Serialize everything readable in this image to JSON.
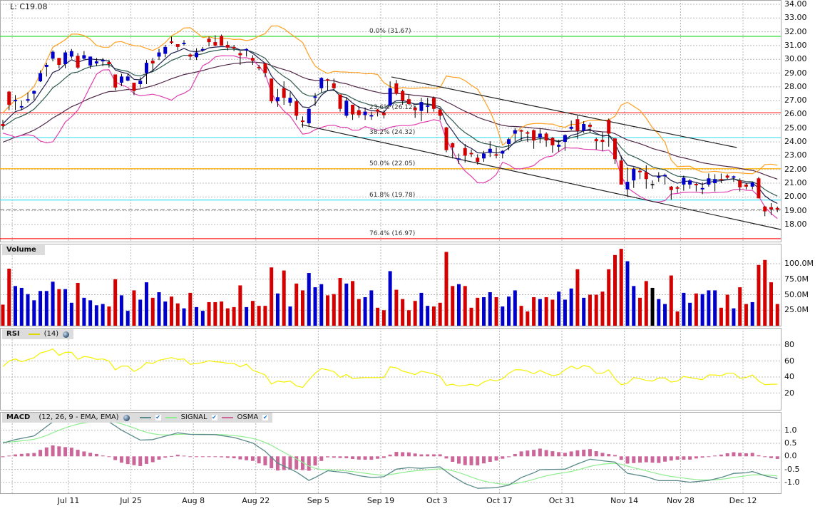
{
  "header": {
    "last_label": "L: C19.08"
  },
  "colors": {
    "up": "#0000cc",
    "down": "#d40000",
    "flat": "#000000",
    "bollinger_upper": "#ffa020",
    "bollinger_lower": "#e040b0",
    "ma_fast": "#202050",
    "ma_mid": "#2d5a50",
    "ma_slow": "#502848",
    "rsi": "#f5f000",
    "macd": "#5a8a8a",
    "signal": "#90ee90",
    "osma": "#cc6699",
    "fib_0": "#33dd33",
    "fib_23_6": "#ff2020",
    "fib_38_2": "#40e0f0",
    "fib_50": "#ffb000",
    "fib_61_8": "#40e0f0",
    "fib_76_4": "#ff2020",
    "grid": "#b8b8b8"
  },
  "panels": {
    "volume": {
      "title": "Volume"
    },
    "rsi": {
      "title": "RSI",
      "params": "(14)"
    },
    "macd": {
      "title": "MACD",
      "params": "(12, 26, 9 - EMA, EMA)",
      "signal_label": "SIGNAL",
      "osma_label": "OSMA"
    }
  },
  "x_axis": {
    "labels": [
      "Jul 11",
      "Jul 25",
      "Aug 8",
      "Aug 22",
      "Sep 5",
      "Sep 19",
      "Oct 3",
      "Oct 17",
      "Oct 31",
      "Nov 14",
      "Nov 28",
      "Dec 12"
    ]
  },
  "chart_data": [
    {
      "type": "candlestick",
      "ylim": [
        17.0,
        34.3
      ],
      "y_ticks": [
        "34.00",
        "33.00",
        "32.00",
        "31.00",
        "30.00",
        "29.00",
        "28.00",
        "27.00",
        "26.00",
        "25.00",
        "24.00",
        "23.00",
        "22.00",
        "21.00",
        "20.00",
        "19.00",
        "18.00"
      ],
      "last_close": 19.08,
      "ohlc": [
        [
          25.3,
          25.6,
          24.9,
          25.15
        ],
        [
          27.65,
          27.7,
          26.3,
          26.7
        ],
        [
          26.95,
          27.4,
          26.3,
          27.05
        ],
        [
          26.5,
          27.0,
          26.3,
          26.6
        ],
        [
          27.0,
          27.6,
          26.85,
          27.1
        ],
        [
          27.5,
          27.75,
          27.05,
          27.7
        ],
        [
          28.4,
          29.2,
          28.35,
          29.0
        ],
        [
          29.45,
          29.75,
          28.75,
          29.6
        ],
        [
          30.05,
          30.65,
          29.85,
          30.55
        ],
        [
          30.1,
          30.1,
          29.35,
          29.6
        ],
        [
          29.65,
          30.65,
          29.35,
          30.5
        ],
        [
          30.2,
          30.75,
          30.05,
          30.6
        ],
        [
          30.25,
          30.45,
          29.3,
          29.4
        ],
        [
          30.05,
          30.6,
          30.0,
          30.3
        ],
        [
          29.55,
          30.2,
          29.3,
          30.2
        ],
        [
          29.7,
          30.1,
          29.5,
          29.85
        ],
        [
          29.85,
          30.1,
          29.5,
          29.95
        ],
        [
          29.8,
          29.95,
          29.4,
          29.65
        ],
        [
          28.9,
          28.9,
          27.75,
          27.95
        ],
        [
          28.3,
          28.95,
          28.05,
          28.75
        ],
        [
          28.45,
          28.95,
          28.4,
          28.75
        ],
        [
          28.3,
          28.3,
          27.4,
          27.7
        ],
        [
          28.2,
          28.7,
          27.95,
          28.45
        ],
        [
          29.0,
          29.95,
          28.2,
          29.75
        ],
        [
          29.9,
          30.1,
          29.1,
          29.7
        ],
        [
          30.2,
          30.75,
          29.95,
          30.5
        ],
        [
          30.4,
          31.05,
          30.15,
          30.9
        ],
        [
          31.3,
          31.65,
          31.1,
          31.2
        ],
        [
          31.1,
          31.1,
          30.65,
          30.9
        ],
        [
          31.1,
          31.4,
          31.0,
          31.2
        ],
        [
          30.35,
          30.45,
          29.95,
          30.2
        ],
        [
          30.15,
          30.8,
          29.95,
          30.5
        ],
        [
          30.65,
          30.9,
          30.55,
          30.75
        ],
        [
          31.5,
          31.65,
          30.95,
          31.25
        ],
        [
          31.25,
          31.75,
          30.95,
          31.0
        ],
        [
          31.7,
          31.8,
          31.0,
          31.0
        ],
        [
          31.05,
          31.3,
          30.65,
          30.85
        ],
        [
          30.9,
          31.05,
          30.6,
          30.8
        ],
        [
          30.45,
          30.6,
          29.6,
          30.3
        ],
        [
          30.65,
          30.8,
          30.2,
          30.75
        ],
        [
          30.1,
          30.3,
          29.6,
          29.9
        ],
        [
          29.45,
          29.6,
          29.2,
          29.35
        ],
        [
          29.7,
          29.75,
          28.7,
          29.0
        ],
        [
          28.6,
          28.6,
          26.8,
          26.95
        ],
        [
          26.95,
          27.85,
          26.55,
          27.25
        ],
        [
          27.9,
          28.4,
          26.7,
          27.2
        ],
        [
          26.85,
          27.6,
          26.6,
          27.2
        ],
        [
          26.95,
          27.05,
          25.6,
          25.9
        ],
        [
          25.55,
          25.85,
          25.05,
          25.45
        ],
        [
          25.35,
          26.45,
          25.15,
          26.4
        ],
        [
          27.2,
          27.55,
          26.6,
          27.3
        ],
        [
          27.9,
          28.7,
          27.6,
          28.65
        ],
        [
          28.55,
          28.6,
          27.7,
          28.45
        ],
        [
          28.25,
          28.6,
          27.7,
          27.9
        ],
        [
          27.45,
          27.45,
          26.2,
          26.4
        ],
        [
          25.9,
          27.25,
          25.75,
          27.0
        ],
        [
          26.7,
          26.7,
          25.6,
          26.0
        ],
        [
          26.3,
          26.6,
          25.75,
          25.95
        ],
        [
          25.95,
          26.5,
          25.6,
          26.2
        ],
        [
          25.85,
          26.2,
          25.6,
          25.95
        ],
        [
          26.35,
          26.4,
          25.85,
          26.2
        ],
        [
          26.1,
          26.3,
          25.7,
          25.95
        ],
        [
          26.65,
          28.4,
          26.55,
          27.9
        ],
        [
          28.25,
          28.5,
          27.4,
          27.5
        ],
        [
          27.7,
          27.8,
          26.7,
          27.0
        ],
        [
          27.1,
          27.4,
          26.7,
          26.75
        ],
        [
          26.5,
          26.6,
          25.75,
          26.3
        ],
        [
          26.25,
          27.2,
          25.5,
          26.9
        ],
        [
          26.55,
          27.2,
          26.1,
          26.65
        ],
        [
          27.2,
          27.3,
          26.2,
          26.4
        ],
        [
          26.35,
          26.45,
          25.6,
          25.9
        ],
        [
          25.05,
          25.1,
          23.25,
          23.4
        ],
        [
          23.9,
          23.95,
          22.8,
          23.6
        ],
        [
          22.75,
          23.15,
          22.4,
          22.8
        ],
        [
          23.55,
          23.85,
          22.5,
          23.0
        ],
        [
          23.2,
          23.45,
          22.9,
          23.1
        ],
        [
          22.85,
          23.1,
          22.35,
          22.55
        ],
        [
          22.8,
          23.35,
          22.55,
          23.15
        ],
        [
          23.2,
          24.05,
          22.9,
          23.5
        ],
        [
          23.1,
          23.6,
          22.8,
          23.0
        ],
        [
          23.15,
          23.4,
          22.8,
          23.35
        ],
        [
          23.85,
          24.3,
          23.4,
          24.2
        ],
        [
          24.6,
          25.0,
          24.05,
          24.85
        ],
        [
          24.85,
          24.9,
          24.05,
          24.75
        ],
        [
          24.7,
          24.8,
          24.0,
          24.6
        ],
        [
          24.85,
          24.9,
          23.5,
          24.1
        ],
        [
          24.3,
          24.95,
          23.9,
          24.6
        ],
        [
          24.6,
          24.7,
          23.65,
          24.1
        ],
        [
          24.3,
          24.35,
          23.2,
          23.75
        ],
        [
          23.65,
          24.15,
          23.3,
          23.8
        ],
        [
          24.0,
          24.55,
          23.35,
          24.5
        ],
        [
          24.95,
          25.55,
          24.85,
          25.1
        ],
        [
          25.65,
          25.9,
          24.2,
          24.8
        ],
        [
          24.8,
          25.5,
          24.65,
          25.3
        ],
        [
          25.25,
          25.4,
          24.65,
          25.1
        ],
        [
          24.2,
          24.3,
          23.45,
          24.05
        ],
        [
          24.15,
          24.7,
          23.35,
          24.0
        ],
        [
          25.6,
          25.7,
          23.65,
          24.6
        ],
        [
          24.25,
          24.3,
          22.4,
          22.75
        ],
        [
          22.65,
          23.0,
          20.9,
          20.9
        ],
        [
          20.55,
          22.15,
          20.0,
          21.1
        ],
        [
          21.2,
          22.15,
          20.65,
          22.05
        ],
        [
          21.9,
          22.1,
          21.3,
          21.8
        ],
        [
          21.8,
          22.3,
          20.6,
          21.3
        ],
        [
          20.93,
          21.2,
          20.6,
          20.93
        ],
        [
          21.4,
          21.8,
          21.1,
          21.5
        ],
        [
          21.5,
          21.7,
          20.9,
          21.6
        ],
        [
          20.75,
          20.8,
          19.8,
          20.5
        ],
        [
          20.7,
          20.8,
          20.3,
          20.6
        ],
        [
          20.9,
          21.55,
          20.45,
          21.4
        ],
        [
          20.9,
          21.3,
          20.6,
          21.2
        ],
        [
          20.95,
          21.0,
          20.4,
          20.85
        ],
        [
          20.55,
          21.05,
          20.2,
          20.65
        ],
        [
          20.9,
          21.7,
          20.75,
          21.35
        ],
        [
          21.0,
          21.65,
          20.4,
          21.3
        ],
        [
          21.3,
          21.7,
          21.0,
          21.25
        ],
        [
          21.55,
          21.65,
          21.3,
          21.4
        ],
        [
          21.4,
          21.55,
          21.1,
          21.5
        ],
        [
          21.2,
          21.35,
          20.4,
          20.7
        ],
        [
          20.9,
          21.0,
          20.55,
          20.75
        ],
        [
          20.75,
          21.1,
          20.55,
          21.05
        ],
        [
          21.35,
          21.45,
          19.9,
          19.9
        ],
        [
          19.3,
          19.35,
          18.6,
          18.95
        ],
        [
          19.25,
          19.55,
          18.7,
          19.1
        ],
        [
          19.2,
          19.3,
          18.9,
          19.08
        ]
      ],
      "fibonacci": [
        {
          "label": "0.0% (31.67)",
          "price": 31.67,
          "color_key": "fib_0"
        },
        {
          "label": "23.6% (26.12)",
          "price": 26.12,
          "color_key": "fib_23_6"
        },
        {
          "label": "38.2% (24.32)",
          "price": 24.32,
          "color_key": "fib_38_2"
        },
        {
          "label": "50.0% (22.05)",
          "price": 22.05,
          "color_key": "fib_50"
        },
        {
          "label": "61.8% (19.78)",
          "price": 19.78,
          "color_key": "fib_61_8"
        },
        {
          "label": "76.4% (16.97)",
          "price": 16.97,
          "color_key": "fib_76_4"
        }
      ],
      "trendlines": [
        [
          [
            47.8,
            25.25
          ],
          [
            124.6,
            17.63
          ]
        ],
        [
          [
            62.2,
            28.72
          ],
          [
            117.5,
            23.59
          ]
        ]
      ],
      "overlays": [
        "bollinger",
        "ema-fast",
        "ema-mid",
        "ema-slow"
      ]
    },
    {
      "type": "bar",
      "name": "Volume",
      "unit": "M",
      "y_ticks": [
        "100.0M",
        "75.0M",
        "50.0M",
        "25.0M"
      ],
      "values": [
        34,
        92,
        64,
        61,
        51,
        41,
        56,
        56,
        71,
        59,
        59,
        37,
        69,
        45,
        41,
        33,
        35,
        31,
        75,
        49,
        24,
        57,
        42,
        70,
        45,
        54,
        39,
        47,
        36,
        28,
        53,
        30,
        24,
        38,
        38,
        39,
        28,
        30,
        65,
        30,
        40,
        32,
        32,
        94,
        52,
        89,
        31,
        68,
        57,
        85,
        62,
        67,
        49,
        51,
        77,
        68,
        72,
        43,
        46,
        57,
        29,
        25,
        88,
        58,
        43,
        25,
        40,
        53,
        32,
        31,
        37,
        119,
        64,
        67,
        64,
        29,
        45,
        46,
        54,
        46,
        31,
        47,
        57,
        32,
        23,
        46,
        43,
        46,
        42,
        55,
        42,
        60,
        91,
        45,
        50,
        50,
        55,
        91,
        114,
        124,
        104,
        64,
        45,
        72,
        61,
        43,
        35,
        81,
        23,
        53,
        37,
        52,
        51,
        57,
        57,
        29,
        50,
        28,
        62,
        35,
        38,
        98,
        106,
        70,
        35
      ]
    },
    {
      "type": "line",
      "name": "RSI",
      "y_ticks": [
        "80",
        "60",
        "40",
        "20"
      ],
      "values": [
        53,
        60,
        62.5,
        59,
        61.6,
        64,
        70,
        72,
        75,
        67,
        70.8,
        70.8,
        62,
        65.5,
        64.6,
        62,
        62.5,
        60,
        49,
        53.6,
        53.6,
        47,
        51,
        58,
        57,
        61,
        62.5,
        64.3,
        62,
        62.5,
        55.7,
        57,
        58,
        60.4,
        59,
        58.6,
        57,
        56.9,
        52.7,
        56,
        48.5,
        45.6,
        42.6,
        31.3,
        35,
        33.7,
        35,
        29,
        27,
        36.4,
        44.7,
        50.6,
        49,
        46.8,
        39.6,
        43,
        38,
        38.8,
        39.3,
        39.3,
        39.3,
        39.3,
        52.7,
        51.5,
        47.4,
        45.3,
        43,
        47.4,
        45.6,
        43.8,
        41,
        29.6,
        31,
        28.7,
        29.6,
        31,
        28.7,
        33.7,
        36.7,
        35.2,
        37.9,
        44.7,
        49,
        49,
        47.4,
        44,
        48.2,
        44.7,
        41.7,
        43,
        49,
        53.6,
        50,
        54.5,
        52.4,
        44.7,
        44.7,
        49,
        37.9,
        30.4,
        32.2,
        39.3,
        38,
        35.8,
        34.9,
        38.8,
        38.8,
        33.7,
        34.9,
        40.8,
        39.3,
        37.9,
        36.7,
        42.6,
        42.6,
        41.7,
        44.7,
        44.7,
        38.5,
        39.3,
        42.6,
        35,
        30.4,
        31,
        31
      ]
    },
    {
      "type": "line",
      "name": "MACD",
      "y_ticks": [
        "1.0",
        "0.5",
        "0.0",
        "-0.5",
        "-1.0"
      ],
      "macd_points": [
        [
          0,
          0.51
        ],
        [
          2,
          0.64
        ],
        [
          5,
          0.78
        ],
        [
          8,
          1.32
        ],
        [
          11,
          1.5
        ],
        [
          15,
          1.43
        ],
        [
          17,
          1.32
        ],
        [
          19,
          1.0
        ],
        [
          22,
          0.62
        ],
        [
          24,
          0.64
        ],
        [
          28,
          0.9
        ],
        [
          30,
          0.84
        ],
        [
          34,
          0.83
        ],
        [
          37,
          0.72
        ],
        [
          40,
          0.51
        ],
        [
          42,
          0.19
        ],
        [
          44,
          -0.26
        ],
        [
          47,
          -0.6
        ],
        [
          49,
          -0.92
        ],
        [
          50,
          -0.81
        ],
        [
          52,
          -0.55
        ],
        [
          55,
          -0.63
        ],
        [
          57,
          -0.74
        ],
        [
          59,
          -0.81
        ],
        [
          61,
          -0.78
        ],
        [
          63,
          -0.49
        ],
        [
          65,
          -0.43
        ],
        [
          67,
          -0.46
        ],
        [
          70,
          -0.4
        ],
        [
          72,
          -0.76
        ],
        [
          74,
          -1.04
        ],
        [
          76,
          -1.22
        ],
        [
          79,
          -1.2
        ],
        [
          81,
          -1.1
        ],
        [
          83,
          -0.81
        ],
        [
          85,
          -0.63
        ],
        [
          86,
          -0.51
        ],
        [
          90,
          -0.49
        ],
        [
          92,
          -0.29
        ],
        [
          94,
          -0.11
        ],
        [
          96,
          -0.17
        ],
        [
          98,
          -0.22
        ],
        [
          100,
          -0.65
        ],
        [
          103,
          -0.78
        ],
        [
          105,
          -0.93
        ],
        [
          108,
          -0.93
        ],
        [
          110,
          -0.99
        ],
        [
          113,
          -0.92
        ],
        [
          115,
          -0.81
        ],
        [
          117,
          -0.65
        ],
        [
          119,
          -0.63
        ],
        [
          120,
          -0.58
        ],
        [
          122,
          -0.74
        ],
        [
          124,
          -0.85
        ]
      ]
    }
  ]
}
